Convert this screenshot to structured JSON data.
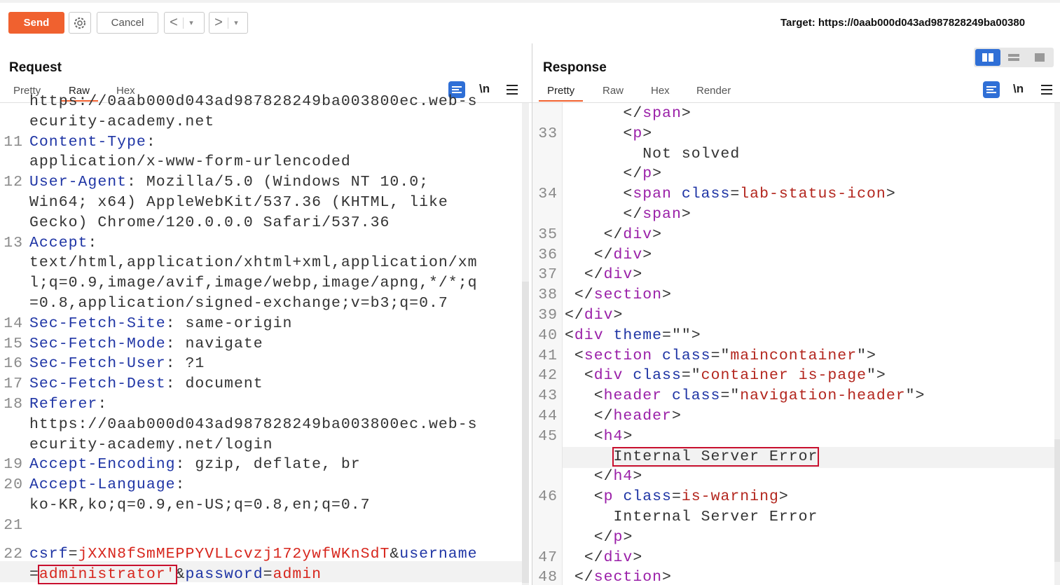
{
  "toolbar": {
    "send_label": "Send",
    "cancel_label": "Cancel",
    "back_arrow": "<",
    "forward_arrow": ">",
    "dropdown_glyph": "▾",
    "target_text": "Target: https://0aab000d043ad987828249ba00380"
  },
  "request": {
    "title": "Request",
    "tabs": [
      "Pretty",
      "Raw",
      "Hex"
    ],
    "active_tab": "Raw",
    "newline_toggle": "\\n",
    "lines": [
      {
        "n": "",
        "k": "",
        "v": "https://0aab000d043ad987828249ba003800ec.web-s"
      },
      {
        "n": "",
        "k": "",
        "v": "ecurity-academy.net"
      },
      {
        "n": "11",
        "k": "Content-Type",
        "v": ":"
      },
      {
        "n": "",
        "k": "",
        "v": "application/x-www-form-urlencoded"
      },
      {
        "n": "12",
        "k": "User-Agent",
        "v": ": Mozilla/5.0 (Windows NT 10.0;"
      },
      {
        "n": "",
        "k": "",
        "v": "Win64; x64) AppleWebKit/537.36 (KHTML, like"
      },
      {
        "n": "",
        "k": "",
        "v": "Gecko) Chrome/120.0.0.0 Safari/537.36"
      },
      {
        "n": "13",
        "k": "Accept",
        "v": ":"
      },
      {
        "n": "",
        "k": "",
        "v": "text/html,application/xhtml+xml,application/xm"
      },
      {
        "n": "",
        "k": "",
        "v": "l;q=0.9,image/avif,image/webp,image/apng,*/*;q"
      },
      {
        "n": "",
        "k": "",
        "v": "=0.8,application/signed-exchange;v=b3;q=0.7"
      },
      {
        "n": "14",
        "k": "Sec-Fetch-Site",
        "v": ": same-origin"
      },
      {
        "n": "15",
        "k": "Sec-Fetch-Mode",
        "v": ": navigate"
      },
      {
        "n": "16",
        "k": "Sec-Fetch-User",
        "v": ": ?1"
      },
      {
        "n": "17",
        "k": "Sec-Fetch-Dest",
        "v": ": document"
      },
      {
        "n": "18",
        "k": "Referer",
        "v": ":"
      },
      {
        "n": "",
        "k": "",
        "v": "https://0aab000d043ad987828249ba003800ec.web-s"
      },
      {
        "n": "",
        "k": "",
        "v": "ecurity-academy.net/login"
      },
      {
        "n": "19",
        "k": "Accept-Encoding",
        "v": ": gzip, deflate, br"
      },
      {
        "n": "20",
        "k": "Accept-Language",
        "v": ":"
      },
      {
        "n": "",
        "k": "",
        "v": "ko-KR,ko;q=0.9,en-US;q=0.8,en;q=0.7"
      },
      {
        "n": "21",
        "k": "",
        "v": ""
      }
    ],
    "body_line_number": "22",
    "body": {
      "csrf_key": "csrf",
      "eq": "=",
      "csrf_value": "jXXN8fSmMEPPYVLLcvzj172ywfWKnSdT",
      "amp": "&",
      "username_key": "username",
      "username_value": "administrator'",
      "password_key": "password",
      "password_value": "admin"
    }
  },
  "response": {
    "title": "Response",
    "tabs": [
      "Pretty",
      "Raw",
      "Hex",
      "Render"
    ],
    "active_tab": "Pretty",
    "newline_toggle": "\\n",
    "lines": [
      {
        "n": "",
        "html": "      </span>"
      },
      {
        "n": "33",
        "html": "      <p>"
      },
      {
        "n": "",
        "html": "        Not solved"
      },
      {
        "n": "",
        "html": "      </p>"
      },
      {
        "n": "34",
        "html": "      <span class=lab-status-icon>"
      },
      {
        "n": "",
        "html": "      </span>"
      },
      {
        "n": "35",
        "html": "    </div>"
      },
      {
        "n": "36",
        "html": "   </div>"
      },
      {
        "n": "37",
        "html": "  </div>"
      },
      {
        "n": "38",
        "html": " </section>"
      },
      {
        "n": "39",
        "html": "</div>"
      },
      {
        "n": "40",
        "html": "<div theme=\"\">"
      },
      {
        "n": "41",
        "html": " <section class=\"maincontainer\">"
      },
      {
        "n": "42",
        "html": "  <div class=\"container is-page\">"
      },
      {
        "n": "43",
        "html": "   <header class=\"navigation-header\">"
      },
      {
        "n": "44",
        "html": "   </header>"
      },
      {
        "n": "45",
        "html": "   <h4>"
      },
      {
        "n": "",
        "html": "     Internal Server Error"
      },
      {
        "n": "",
        "html": "   </h4>"
      },
      {
        "n": "46",
        "html": "   <p class=is-warning>"
      },
      {
        "n": "",
        "html": "     Internal Server Error"
      },
      {
        "n": "",
        "html": "   </p>"
      },
      {
        "n": "47",
        "html": "  </div>"
      },
      {
        "n": "48",
        "html": " </section>"
      }
    ]
  }
}
